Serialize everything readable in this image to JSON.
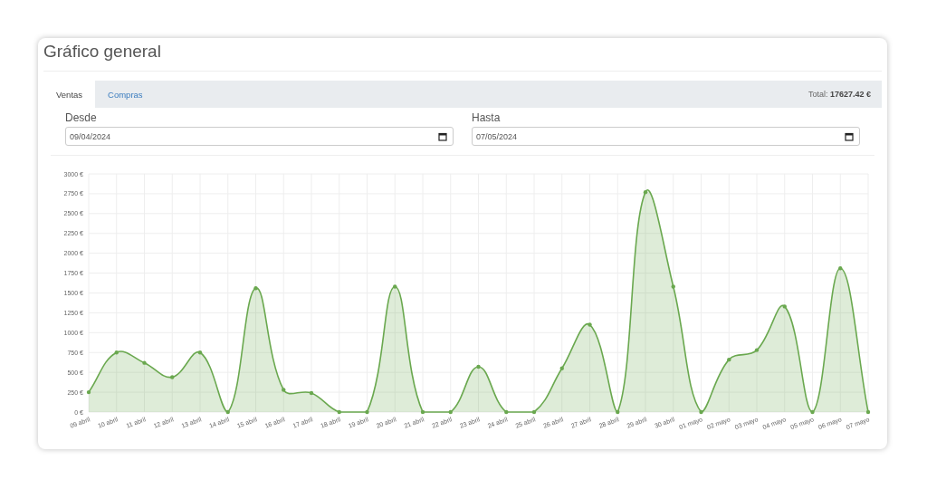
{
  "card": {
    "title": "Gráfico general"
  },
  "tabs": [
    {
      "label": "Ventas",
      "selected": true
    },
    {
      "label": "Compras",
      "selected": false
    }
  ],
  "total": "Total: **17627.42 €**",
  "filters": [
    {
      "label": "Desde",
      "value": "09/04/2024"
    },
    {
      "label": "Hasta",
      "value": "07/05/2024"
    }
  ],
  "chart_data": {
    "type": "area",
    "categories": [
      "09 abril",
      "10 abril",
      "11 abril",
      "12 abril",
      "13 abril",
      "14 abril",
      "15 abril",
      "16 abril",
      "17 abril",
      "18 abril",
      "19 abril",
      "20 abril",
      "21 abril",
      "22 abril",
      "23 abril",
      "24 abril",
      "25 abril",
      "26 abril",
      "27 abril",
      "28 abril",
      "29 abril",
      "30 abril",
      "01 mayo",
      "02 mayo",
      "03 mayo",
      "04 mayo",
      "05 mayo",
      "06 mayo",
      "07 mayo"
    ],
    "grid": true,
    "series": [
      {
        "color": "#6aa84f",
        "values": [
          250,
          750,
          620,
          440,
          750,
          0,
          1560,
          280,
          240,
          0,
          0,
          1580,
          0,
          0,
          570,
          0,
          0,
          550,
          1100,
          0,
          2770,
          1580,
          0,
          660,
          780,
          1330,
          0,
          1810,
          0
        ]
      }
    ],
    "ylim": [
      0,
      3000
    ],
    "yticks": [
      {
        "value": 0,
        "label": "0 €"
      },
      {
        "value": 250,
        "label": "250 €"
      },
      {
        "value": 500,
        "label": "500 €"
      },
      {
        "value": 750,
        "label": "750 €"
      },
      {
        "value": 1000,
        "label": "1000 €"
      },
      {
        "value": 1250,
        "label": "1250 €"
      },
      {
        "value": 1500,
        "label": "1500 €"
      },
      {
        "value": 1750,
        "label": "1750 €"
      },
      {
        "value": 2000,
        "label": "2000 €"
      },
      {
        "value": 2250,
        "label": "2250 €"
      },
      {
        "value": 2500,
        "label": "2500 €"
      },
      {
        "value": 2750,
        "label": "2750 €"
      },
      {
        "value": 3000,
        "label": "3000 €"
      }
    ]
  }
}
